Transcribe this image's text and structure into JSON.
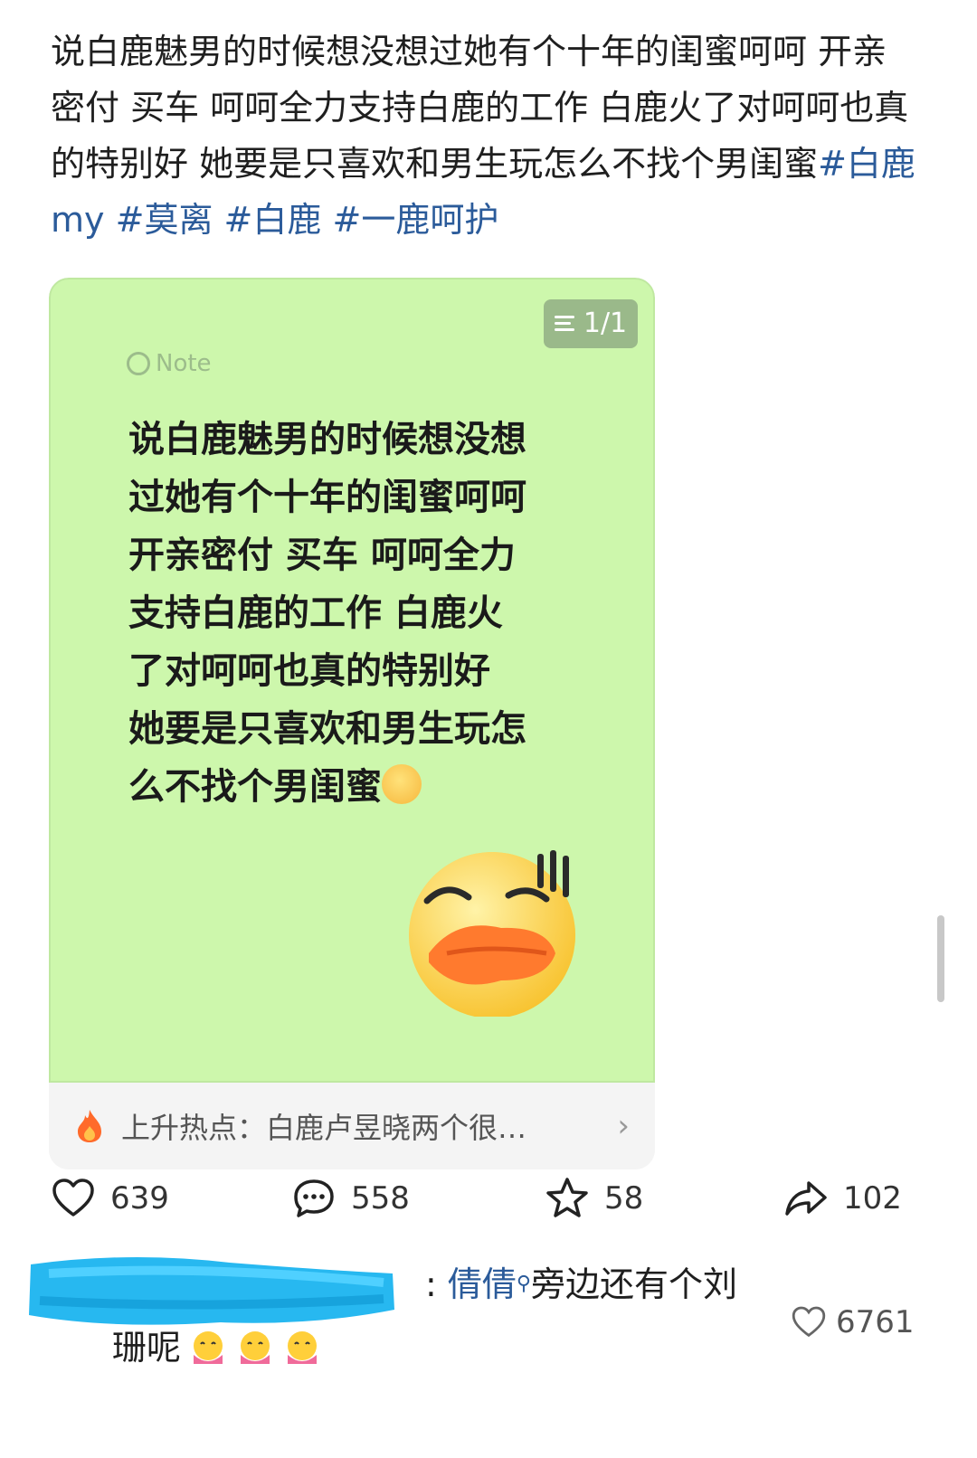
{
  "post": {
    "text_plain": "说白鹿魅男的时候想没想过她有个十年的闺蜜呵呵 开亲密付 买车 呵呵全力支持白鹿的工作 白鹿火了对呵呵也真的特别好 她要是只喜欢和男生玩怎么不找个男闺蜜",
    "hashtags": [
      "#白鹿my",
      "#莫离",
      "#白鹿",
      "#一鹿呵护"
    ]
  },
  "note_card": {
    "page_indicator": "1/1",
    "note_label": "Note",
    "lines": [
      "说白鹿魅男的时候想没想",
      "过她有个十年的闺蜜呵呵",
      "开亲密付 买车 呵呵全力",
      "支持白鹿的工作 白鹿火",
      "了对呵呵也真的特别好",
      "她要是只喜欢和男生玩怎",
      "么不找个男闺蜜"
    ],
    "icons": [
      "sweat-smile-emoji",
      "duck-face-sticker"
    ]
  },
  "hot_topic": {
    "text": "上升热点：白鹿卢昱晓两个很…",
    "icon": "flame-icon"
  },
  "actions": {
    "likes": "639",
    "comments": "558",
    "favorites": "58",
    "shares": "102"
  },
  "top_comment": {
    "commenter": "倩倩",
    "text_line1": "旁边还有个刘",
    "text_line2": "珊呢",
    "likes": "6761",
    "emojis": [
      "hug-emoji",
      "hug-emoji",
      "hug-emoji"
    ]
  },
  "colors": {
    "hashtag": "#2b5b9a",
    "note_bg": "#cdf7ac",
    "highlight": "#b9dcf3"
  }
}
